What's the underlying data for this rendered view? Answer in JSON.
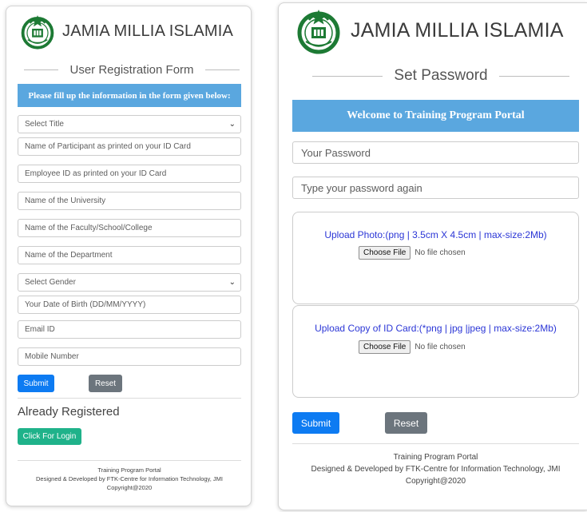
{
  "brand": {
    "name": "JAMIA MILLIA ISLAMIA"
  },
  "registration": {
    "heading": "User Registration Form",
    "banner": "Please fill up the information in the form given below:",
    "fields": [
      {
        "text": "Select Title",
        "kind": "select"
      },
      {
        "text": "Name of Participant as printed on your ID Card",
        "kind": "input"
      },
      {
        "text": "Employee ID as printed on your ID Card",
        "kind": "input"
      },
      {
        "text": "Name of the University",
        "kind": "input"
      },
      {
        "text": "Name of the Faculty/School/College",
        "kind": "input"
      },
      {
        "text": "Name of the Department",
        "kind": "input"
      },
      {
        "text": "Select Gender",
        "kind": "select"
      },
      {
        "text": "Your Date of Birth (DD/MM/YYYY)",
        "kind": "input"
      },
      {
        "text": "Email ID",
        "kind": "input"
      },
      {
        "text": "Mobile Number",
        "kind": "input"
      }
    ],
    "submit_label": "Submit",
    "reset_label": "Reset",
    "already_registered": "Already Registered",
    "login_label": "Click For Login",
    "footer": {
      "line1": "Training Program Portal",
      "line2": "Designed & Developed by FTK-Centre for Information Technology, JMI",
      "line3": "Copyright@2020"
    }
  },
  "set_password": {
    "heading": "Set Password",
    "banner": "Welcome to Training Program Portal",
    "password_placeholder": "Your Password",
    "confirm_placeholder": "Type your password again",
    "upload_photo": {
      "title": "Upload Photo:(png | 3.5cm X 4.5cm | max-size:2Mb)",
      "button": "Choose File",
      "status": "No file chosen"
    },
    "upload_id": {
      "title": "Upload Copy of ID Card:(*png | jpg |jpeg | max-size:2Mb)",
      "button": "Choose File",
      "status": "No file chosen"
    },
    "submit_label": "Submit",
    "reset_label": "Reset",
    "footer": {
      "line1": "Training Program Portal",
      "line2": "Designed & Developed by FTK-Centre for Information Technology, JMI",
      "line3": "Copyright@2020"
    }
  },
  "colors": {
    "banner": "#5aa7df",
    "primary": "#0d7bf2",
    "secondary": "#6c757d",
    "success": "#1fb28a",
    "upload_text": "#2b36d6",
    "logo_green": "#1d7a34"
  },
  "icons": [
    "university-logo-icon",
    "chevron-down-icon"
  ]
}
